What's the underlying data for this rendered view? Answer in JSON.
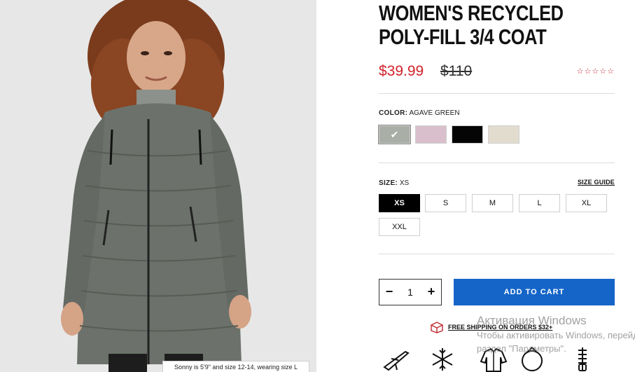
{
  "product": {
    "title": "WOMEN'S RECYCLED POLY-FILL 3/4 COAT",
    "image_caption": "Sonny is 5'9\" and size 12-14, wearing size L"
  },
  "price": {
    "sale": "$39.99",
    "original": "$110",
    "sale_color": "#d0222b"
  },
  "rating": {
    "stars_filled": 0,
    "stars_total": 5,
    "stars_text": "☆☆☆☆☆"
  },
  "color": {
    "label": "COLOR:",
    "selected": "AGAVE GREEN",
    "swatches": [
      {
        "name": "Agave Green",
        "hex": "#a9aea6",
        "selected": true,
        "check": "✔"
      },
      {
        "name": "Pink",
        "hex": "#d9bfcb",
        "selected": false
      },
      {
        "name": "Black",
        "hex": "#050505",
        "selected": false
      },
      {
        "name": "Beige",
        "hex": "#e2dccf",
        "selected": false
      }
    ]
  },
  "size": {
    "label": "SIZE:",
    "selected": "XS",
    "guide_label": "SIZE GUIDE",
    "options": [
      "XS",
      "S",
      "M",
      "L",
      "XL",
      "XXL"
    ]
  },
  "quantity": {
    "minus": "−",
    "value": "1",
    "plus": "+"
  },
  "cart": {
    "label": "ADD TO CART",
    "color": "#1565c8"
  },
  "shipping": {
    "label": "FREE SHIPPING ON ORDERS $32+"
  },
  "features": [
    "travel-icon",
    "snowflake-icon",
    "packable-jacket-icon",
    "lightweight-icon",
    "zipper-icon"
  ],
  "watermark": {
    "line1": "Активация Windows",
    "line2": "Чтобы активировать Windows, перейдите в",
    "line3": "раздел \"Параметры\"."
  }
}
